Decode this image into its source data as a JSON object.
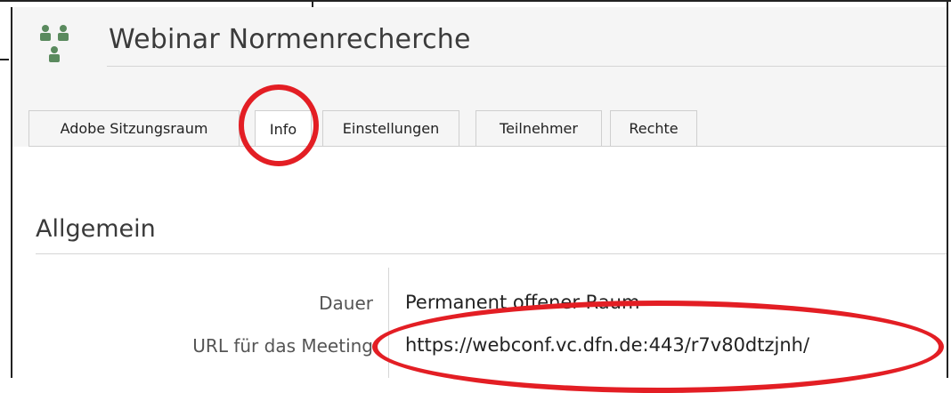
{
  "header": {
    "title": "Webinar Normenrecherche",
    "icon": "group-icon"
  },
  "tabs": [
    {
      "label": "Adobe Sitzungsraum",
      "active": false
    },
    {
      "label": "Info",
      "active": true
    },
    {
      "label": "Einstellungen",
      "active": false
    },
    {
      "label": "Teilnehmer",
      "active": false
    },
    {
      "label": "Rechte",
      "active": false
    }
  ],
  "section": {
    "title": "Allgemein",
    "rows": [
      {
        "label": "Dauer",
        "value": "Permanent offener Raum"
      },
      {
        "label": "URL für das Meeting",
        "value": "https://webconf.vc.dfn.de:443/r7v80dtzjnh/"
      }
    ]
  },
  "colors": {
    "accent_icon": "#5a8a5e",
    "annotation": "#e31e24"
  }
}
